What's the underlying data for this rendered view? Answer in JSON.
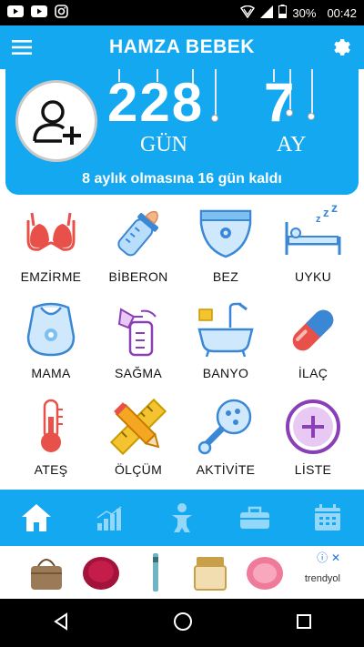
{
  "status": {
    "battery": "30%",
    "time": "00:42"
  },
  "app": {
    "title": "HAMZA BEBEK"
  },
  "counter": {
    "days": "228",
    "months": "7",
    "days_label": "GÜN",
    "months_label": "AY",
    "remaining_text": "8 aylık olmasına 16 gün kaldı"
  },
  "tiles": [
    {
      "label": "EMZİRME",
      "icon": "bra-icon"
    },
    {
      "label": "BİBERON",
      "icon": "baby-bottle-icon"
    },
    {
      "label": "BEZ",
      "icon": "diaper-icon"
    },
    {
      "label": "UYKU",
      "icon": "sleep-bed-icon"
    },
    {
      "label": "MAMA",
      "icon": "bib-icon"
    },
    {
      "label": "SAĞMA",
      "icon": "breast-pump-icon"
    },
    {
      "label": "BANYO",
      "icon": "bathtub-icon"
    },
    {
      "label": "İLAÇ",
      "icon": "pill-icon"
    },
    {
      "label": "ATEŞ",
      "icon": "thermometer-icon"
    },
    {
      "label": "ÖLÇÜM",
      "icon": "ruler-pencil-icon"
    },
    {
      "label": "AKTİVİTE",
      "icon": "rattle-icon"
    },
    {
      "label": "LİSTE",
      "icon": "plus-circle-icon"
    }
  ],
  "bottom_nav": [
    "home-icon",
    "chart-icon",
    "baby-icon",
    "toolbox-icon",
    "calendar-icon"
  ],
  "ad": {
    "brand": "trendyol",
    "close": "ⓘ ✕"
  },
  "colors": {
    "primary": "#13a8f0",
    "accent_red": "#e8504a"
  }
}
